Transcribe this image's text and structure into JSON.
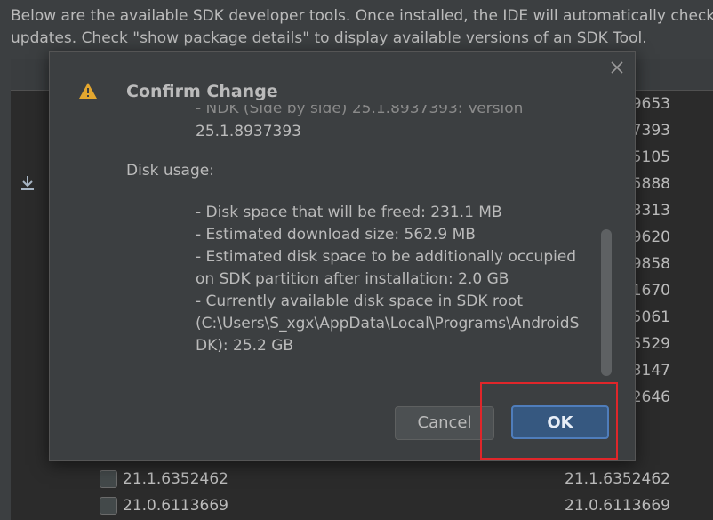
{
  "background": {
    "description_line1": "Below are the available SDK developer tools. Once installed, the IDE will automatically check",
    "description_line2": "updates. Check \"show package details\" to display available versions of an SDK Tool.",
    "version_suffixes": [
      "9653",
      "7393",
      "5105",
      "5888",
      "3313",
      "9620",
      "9858",
      "1670",
      "5061",
      "5529",
      "3147",
      "2646"
    ],
    "rows": [
      {
        "name": "21.1.6352462",
        "version": "21.1.6352462"
      },
      {
        "name": "21.0.6113669",
        "version": "21.0.6113669"
      }
    ]
  },
  "dialog": {
    "title": "Confirm Change",
    "clipped_line": "- NDK (Side by side) 25.1.8937393: Version",
    "continued_line": "25.1.8937393",
    "disk_usage_heading": "Disk usage:",
    "disk_lines": [
      "- Disk space that will be freed: 231.1 MB",
      "- Estimated download size: 562.9 MB",
      "- Estimated disk space to be additionally occupied",
      "on SDK partition after installation: 2.0 GB",
      "- Currently available disk space in SDK root",
      "(C:\\Users\\S_xgx\\AppData\\Local\\Programs\\AndroidS",
      "DK): 25.2 GB"
    ],
    "cancel_label": "Cancel",
    "ok_label": "OK"
  },
  "colors": {
    "dialog_bg": "#3c3f41",
    "ok_accent": "#365880",
    "warning": "#e3a72f",
    "highlight": "#e0262a"
  }
}
